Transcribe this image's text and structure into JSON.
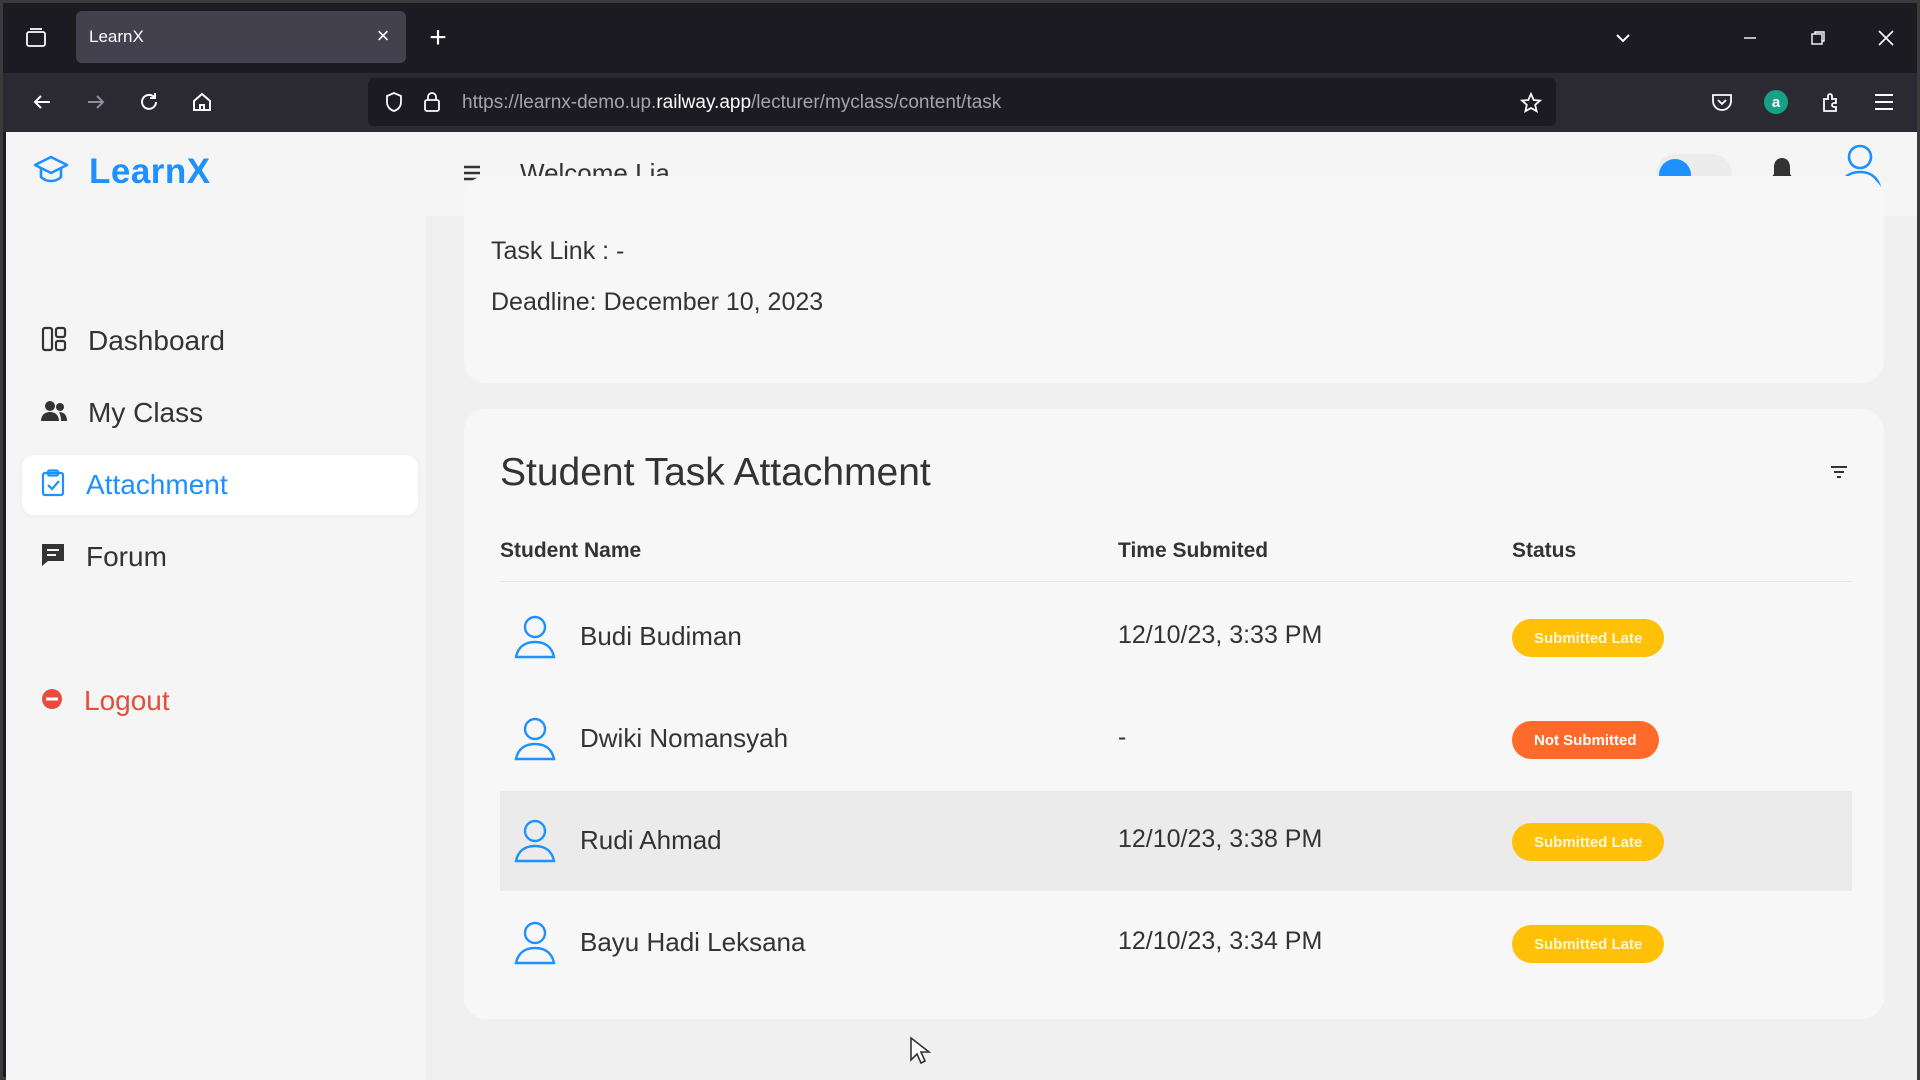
{
  "browser": {
    "tab_title": "LearnX",
    "url_prefix": "https://learnx-demo.up.",
    "url_domain": "railway.app",
    "url_path": "/lecturer/myclass/content/task"
  },
  "header": {
    "brand": "LearnX",
    "welcome": "Welcome Lia",
    "theme_toggle_on": true
  },
  "sidebar": {
    "items": [
      {
        "label": "Dashboard",
        "icon": "dashboard-icon"
      },
      {
        "label": "My Class",
        "icon": "users-icon"
      },
      {
        "label": "Attachment",
        "icon": "clipboard-check-icon",
        "active": true
      },
      {
        "label": "Forum",
        "icon": "message-icon"
      }
    ],
    "logout": "Logout"
  },
  "task": {
    "link_line": "Task Link : -",
    "deadline_line": "Deadline: December 10, 2023"
  },
  "attachments": {
    "title": "Student Task Attachment",
    "columns": [
      "Student Name",
      "Time Submited",
      "Status"
    ],
    "rows": [
      {
        "name": "Budi Budiman",
        "time": "12/10/23, 3:33 PM",
        "status": "Submitted Late",
        "status_color": "#ffc107"
      },
      {
        "name": "Dwiki Nomansyah",
        "time": "-",
        "status": "Not Submitted",
        "status_color": "#ff6a2b"
      },
      {
        "name": "Rudi Ahmad",
        "time": "12/10/23, 3:38 PM",
        "status": "Submitted Late",
        "status_color": "#ffc107"
      },
      {
        "name": "Bayu Hadi Leksana",
        "time": "12/10/23, 3:34 PM",
        "status": "Submitted Late",
        "status_color": "#ffc107"
      }
    ]
  },
  "colors": {
    "accent": "#1e90ff",
    "logout": "#e74c3c"
  }
}
